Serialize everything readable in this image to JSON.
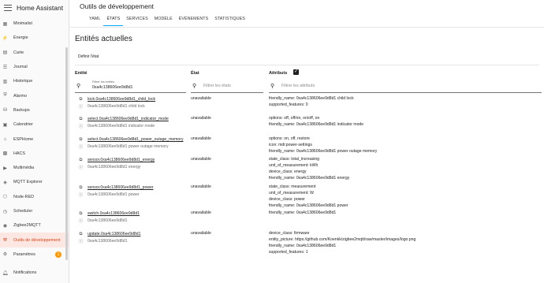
{
  "sidebar": {
    "title": "Home Assistant",
    "items": [
      {
        "label": "Minimalist",
        "icon": "dashboard-icon"
      },
      {
        "label": "Énergie",
        "icon": "energy-icon"
      },
      {
        "label": "Carte",
        "icon": "map-icon"
      },
      {
        "label": "Journal",
        "icon": "logbook-icon"
      },
      {
        "label": "Historique",
        "icon": "history-icon"
      },
      {
        "label": "Alarmo",
        "icon": "alarm-icon"
      },
      {
        "label": "Backups",
        "icon": "backup-icon"
      },
      {
        "label": "Calendrier",
        "icon": "calendar-icon"
      },
      {
        "label": "ESPHome",
        "icon": "esphome-icon"
      },
      {
        "label": "HACS",
        "icon": "hacs-icon"
      },
      {
        "label": "Multimédia",
        "icon": "media-icon"
      },
      {
        "label": "MQTT Explorer",
        "icon": "mqtt-icon"
      },
      {
        "label": "Node-RED",
        "icon": "nodered-icon"
      },
      {
        "label": "Scheduler",
        "icon": "scheduler-icon"
      },
      {
        "label": "Zigbee2MQTT",
        "icon": "zigbee-icon"
      },
      {
        "label": "Outils de développement",
        "icon": "developer-tools-icon",
        "active": true
      },
      {
        "label": "Paramètres",
        "icon": "settings-icon",
        "badge": "1"
      }
    ],
    "notifications": "Notifications"
  },
  "header": {
    "title": "Outils de développement",
    "tabs": [
      "YAML",
      "ÉTATS",
      "SERVICES",
      "MODÈLE",
      "ÉVÉNEMENTS",
      "STATISTIQUES"
    ],
    "active_tab": "ÉTATS"
  },
  "main": {
    "section_title": "Entités actuelles",
    "set_state": "Définir l'état",
    "columns": {
      "entity": "Entité",
      "state": "État",
      "attributes": "Attributs"
    },
    "filters": {
      "entity_label": "Filtrer les entités",
      "entity_value": "0xa4c138606ee9d8d1",
      "state_placeholder": "Filtrer les états",
      "attributes_placeholder": "Filtrer les attributs"
    },
    "rows": [
      {
        "entity_id": "lock.0xa4c138606ee9d8d1_child_lock",
        "name": "0xa4c138606ee9d8d1 child lock",
        "state": "unavailable",
        "attributes": [
          "friendly_name: 0xa4c138606ee9d8d1 child lock",
          "supported_features: 0"
        ]
      },
      {
        "entity_id": "select.0xa4c138606ee9d8d1_indicator_mode",
        "name": "0xa4c138606ee9d8d1 indicator mode",
        "state": "unavailable",
        "attributes": [
          "options: off, off/on, on/off, on",
          "friendly_name: 0xa4c138606ee9d8d1 indicator mode"
        ]
      },
      {
        "entity_id": "select.0xa4c138606ee9d8d1_power_outage_memory",
        "name": "0xa4c138606ee9d8d1 power outage memory",
        "state": "unavailable",
        "attributes": [
          "options: on, off, restore",
          "icon: mdi:power-settings",
          "friendly_name: 0xa4c138606ee9d8d1 power outage memory"
        ]
      },
      {
        "entity_id": "sensor.0xa4c138606ee9d8d1_energy",
        "name": "0xa4c138606ee9d8d1 energy",
        "state": "unavailable",
        "attributes": [
          "state_class: total_increasing",
          "unit_of_measurement: kWh",
          "device_class: energy",
          "friendly_name: 0xa4c138606ee9d8d1 energy"
        ]
      },
      {
        "entity_id": "sensor.0xa4c138606ee9d8d1_power",
        "name": "0xa4c138606ee9d8d1 power",
        "state": "unavailable",
        "attributes": [
          "state_class: measurement",
          "unit_of_measurement: W",
          "device_class: power",
          "friendly_name: 0xa4c138606ee9d8d1 power"
        ]
      },
      {
        "entity_id": "switch.0xa4c138606ee9d8d1",
        "name": "0xa4c138606ee9d8d1",
        "state": "unavailable",
        "attributes": [
          "friendly_name: 0xa4c138606ee9d8d1"
        ]
      },
      {
        "entity_id": "update.0xa4c138606ee9d8d1",
        "name": "0xa4c138606ee9d8d1",
        "state": "unavailable",
        "attributes": [
          "device_class: firmware",
          "entity_picture: https://github.com/Koenkk/zigbee2mqtt/raw/master/images/logo.png",
          "friendly_name: 0xa4c138606ee9d8d1",
          "supported_features: 1"
        ]
      }
    ]
  }
}
